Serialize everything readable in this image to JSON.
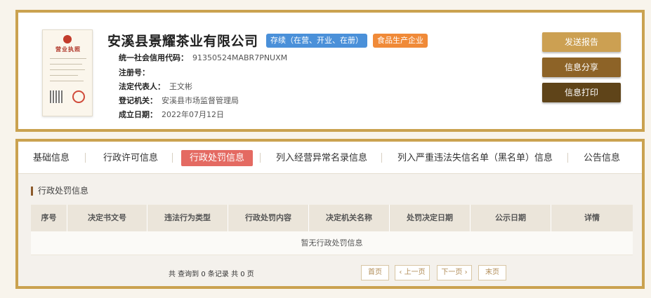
{
  "company": {
    "name": "安溪县景耀茶业有限公司",
    "status_tag": "存续（在营、开业、在册）",
    "industry_tag": "食品生产企业",
    "license_title": "营业执照"
  },
  "info": [
    {
      "label": "统一社会信用代码：",
      "value": "91350524MABR7PNUXM"
    },
    {
      "label": "注册号：",
      "value": ""
    },
    {
      "label": "法定代表人：",
      "value": "王文彬"
    },
    {
      "label": "登记机关：",
      "value": "安溪县市场监督管理局"
    },
    {
      "label": "成立日期：",
      "value": "2022年07月12日"
    }
  ],
  "actions": {
    "report": "发送报告",
    "share": "信息分享",
    "print": "信息打印"
  },
  "tabs": [
    {
      "label": "基础信息"
    },
    {
      "label": "行政许可信息"
    },
    {
      "label": "行政处罚信息",
      "active": true
    },
    {
      "label": "列入经营异常名录信息"
    },
    {
      "label": "列入严重违法失信名单（黑名单）信息"
    },
    {
      "label": "公告信息"
    }
  ],
  "section": {
    "title": "行政处罚信息",
    "columns": [
      "序号",
      "决定书文号",
      "违法行为类型",
      "行政处罚内容",
      "决定机关名称",
      "处罚决定日期",
      "公示日期",
      "详情"
    ],
    "empty_text": "暂无行政处罚信息"
  },
  "pagination": {
    "summary": "共 查询到 0 条记录 共 0 页",
    "first": "首页",
    "prev": "‹ 上一页",
    "next": "下一页 ›",
    "last": "末页"
  },
  "colors": {
    "frame": "#caa250",
    "active_tab": "#e46a62",
    "status_tag": "#4a90d9",
    "industry_tag": "#f08a38"
  }
}
